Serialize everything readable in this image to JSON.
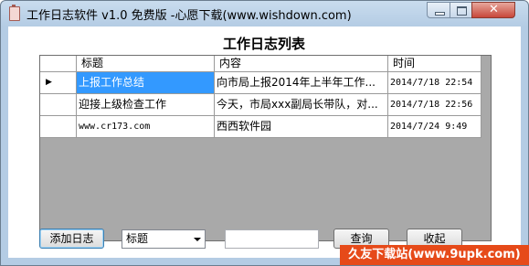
{
  "window": {
    "title": "工作日志软件 v1.0 免费版 -心愿下载(www.wishdown.com)",
    "controls": {
      "minimize": "",
      "maximize": "",
      "close": "✕"
    }
  },
  "heading": "工作日志列表",
  "table": {
    "columns": [
      "",
      "标题",
      "内容",
      "时间"
    ],
    "rows": [
      {
        "marker": "▶",
        "title": "上报工作总结",
        "content": "向市局上报2014年上半年工作...",
        "time": "2014/7/18 22:54",
        "selected": true
      },
      {
        "marker": "",
        "title": "迎接上级检查工作",
        "content": "今天，市局xxx副局长带队，对...",
        "time": "2014/7/18 22:56",
        "selected": false
      },
      {
        "marker": "",
        "title": "www.cr173.com",
        "content": "西西软件园",
        "time": "2014/7/24 9:49",
        "selected": false
      }
    ]
  },
  "toolbar": {
    "add_label": "添加日志",
    "field_select": "标题",
    "search_value": "",
    "query_label": "查询",
    "collapse_label": "收起"
  },
  "watermark": "久友下载站(www.9upk.com)",
  "colors": {
    "selection": "#3399ff",
    "grid_background": "#a9a9a9",
    "frame": "#b4cce4"
  }
}
